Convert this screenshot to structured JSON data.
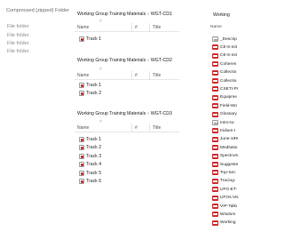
{
  "zip_folder": {
    "title": "Compressed (zipped) Folder",
    "items": [
      "File folder",
      "File folder",
      "File folder",
      "File folder"
    ]
  },
  "windows": [
    {
      "path": [
        "Working Group Training Materials",
        "WGT-CD1"
      ],
      "columns": {
        "name": "Name",
        "number": "#",
        "title": "Title"
      },
      "tracks": [
        "Track 1"
      ]
    },
    {
      "path": [
        "Working Group Training Materials",
        "WGT-CD2"
      ],
      "columns": {
        "name": "Name",
        "number": "#",
        "title": "Title"
      },
      "tracks": [
        "Track 1",
        "Track 2"
      ]
    },
    {
      "path": [
        "Working Group Training Materials",
        "WGT-CD3"
      ],
      "columns": {
        "name": "Name",
        "number": "#",
        "title": "Title"
      },
      "tracks": [
        "Track 1",
        "Track 2",
        "Track 3",
        "Track 4",
        "Track 5",
        "Track 6"
      ]
    }
  ],
  "right_panel": {
    "title": "Working",
    "column_name": "Name",
    "files": [
      {
        "name": "_Descrip",
        "icon": "document-icon"
      },
      {
        "name": "CE-5-Init",
        "icon": "pdf-icon"
      },
      {
        "name": "CE-5-Init",
        "icon": "pdf-icon"
      },
      {
        "name": "Coheren",
        "icon": "pdf-icon"
      },
      {
        "name": "Collectio",
        "icon": "pdf-icon"
      },
      {
        "name": "Collectio",
        "icon": "pdf-icon"
      },
      {
        "name": "CSETI-Pr",
        "icon": "pdf-icon"
      },
      {
        "name": "Equipme",
        "icon": "pdf-icon"
      },
      {
        "name": "Field-Wo",
        "icon": "pdf-icon"
      },
      {
        "name": "Glossary",
        "icon": "pdf-icon"
      },
      {
        "name": "Intro-to-",
        "icon": "document-icon"
      },
      {
        "name": "Iridium-I",
        "icon": "pdf-icon"
      },
      {
        "name": "June-199",
        "icon": "pdf-icon"
      },
      {
        "name": "Meditatio",
        "icon": "pdf-icon"
      },
      {
        "name": "Spectrum",
        "icon": "pdf-icon"
      },
      {
        "name": "Suggeste",
        "icon": "pdf-icon"
      },
      {
        "name": "Top-Sec",
        "icon": "pdf-icon"
      },
      {
        "name": "Tracing-",
        "icon": "pdf-icon"
      },
      {
        "name": "UFO-ET-",
        "icon": "pdf-icon"
      },
      {
        "name": "UFOs-Vis",
        "icon": "pdf-icon"
      },
      {
        "name": "VIP-Talki",
        "icon": "pdf-icon"
      },
      {
        "name": "Wisdom",
        "icon": "pdf-icon"
      },
      {
        "name": "Working",
        "icon": "pdf-icon"
      }
    ]
  }
}
